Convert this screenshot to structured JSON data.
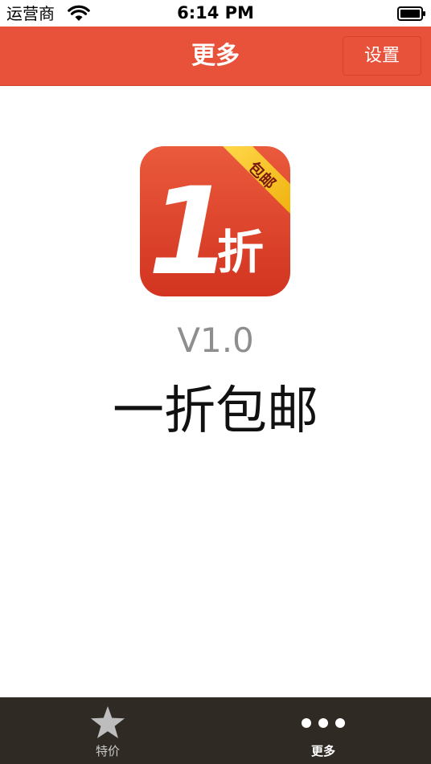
{
  "status_bar": {
    "carrier": "运营商",
    "time": "6:14 PM"
  },
  "nav": {
    "title": "更多",
    "settings_label": "设置"
  },
  "app_icon": {
    "main_text": "1",
    "sub_text": "折",
    "ribbon_text": "包邮",
    "colors": {
      "background": "#e2432a",
      "ribbon": "#f5c21b",
      "text": "#ffffff"
    }
  },
  "content": {
    "version": "V1.0",
    "app_name": "一折包邮"
  },
  "tab_bar": {
    "tabs": [
      {
        "label": "特价",
        "icon": "star-icon",
        "selected": false
      },
      {
        "label": "更多",
        "icon": "more-dots-icon",
        "selected": true
      }
    ]
  },
  "colors": {
    "accent": "#e9523a",
    "tab_bar_bg": "#2f2a23",
    "version_text": "#8e8e8e"
  }
}
